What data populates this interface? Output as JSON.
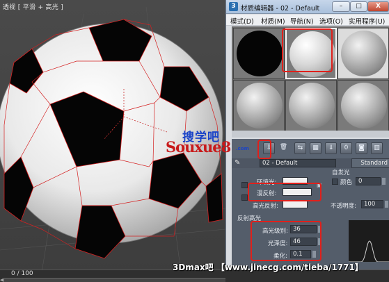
{
  "viewport": {
    "label": "透视 [ 平滑 + 高光 ]"
  },
  "timeline": {
    "counter": "0 / 100"
  },
  "material_editor": {
    "title": "材质编辑器 - 02 - Default",
    "icon_text": "3",
    "window_buttons": {
      "minimize": "–",
      "maximize": "□",
      "close": "X"
    },
    "menu": [
      "模式(D)",
      "材质(M)",
      "导航(N)",
      "选项(O)",
      "实用程序(U)"
    ],
    "slots": [
      {
        "sphere": "black",
        "state": "normal"
      },
      {
        "sphere": "white",
        "state": "selected"
      },
      {
        "sphere": "default",
        "state": "bright"
      },
      {
        "sphere": "default",
        "state": "normal"
      },
      {
        "sphere": "default",
        "state": "normal"
      },
      {
        "sphere": "default",
        "state": "normal"
      }
    ],
    "toolbar_icons": [
      "put-to-scene-icon",
      "delete-icon",
      "make-unique-icon",
      "checker-icon",
      "save-icon",
      "material-id-icon",
      "show-map-icon",
      "background-icon"
    ],
    "material_name": "02 - Default",
    "material_type": "Standard",
    "basic_params": {
      "ambient_label": "环境光:",
      "diffuse_label": "漫反射:",
      "specular_label": "高光反射:",
      "self_illum_label": "自发光",
      "color_label": "颜色",
      "color_value": "0",
      "opacity_label": "不透明度:",
      "opacity_value": "100"
    },
    "specular_highlights": {
      "section_label": "反射高光",
      "level_label": "高光级别:",
      "level_value": "36",
      "gloss_label": "光泽度:",
      "gloss_value": "46",
      "soften_label": "柔化:",
      "soften_value": "0.1"
    }
  },
  "watermarks": {
    "site_cn": "搜学吧",
    "site_en": "Souxue8",
    "site_com": ".com",
    "footer": "3Dmax吧 【www.jinecg.com/tieba/1771】"
  },
  "colors": {
    "highlight_red": "#e0201b",
    "titlebar": "#b7cbe4",
    "panel_bg": "#545d6a"
  }
}
